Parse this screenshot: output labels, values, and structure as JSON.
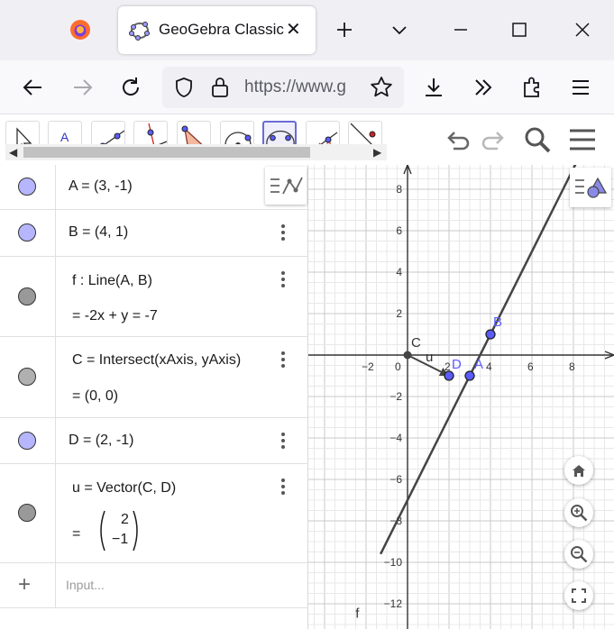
{
  "browser": {
    "tab_title": "GeoGebra Classic",
    "url": "https://www.g"
  },
  "algebra": {
    "rows": [
      {
        "marble": "#b6b6ff",
        "text": "A = (3, -1)"
      },
      {
        "marble": "#b6b6ff",
        "text": "B = (4, 1)"
      },
      {
        "marble": "#999999",
        "text": "f : Line(A, B)",
        "output": "=  -2x + y = -7"
      },
      {
        "marble": "#b0b0b0",
        "text": "C  =  Intersect(xAxis, yAxis)",
        "output": "=  (0, 0)"
      },
      {
        "marble": "#b6b6ff",
        "text": "D = (2, -1)"
      },
      {
        "marble": "#999999",
        "text": "u  =  Vector(C, D)",
        "vector_top": "2",
        "vector_bottom": "−1",
        "output_eq": "="
      }
    ],
    "input_placeholder": "Input...",
    "add_symbol": "+"
  },
  "graph": {
    "x_ticks": [
      "−2",
      "0",
      "2",
      "4",
      "6",
      "8"
    ],
    "y_ticks": [
      "8",
      "6",
      "4",
      "2",
      "−2",
      "−4",
      "−6",
      "−8",
      "−10",
      "−12"
    ],
    "labels": {
      "A": "A",
      "B": "B",
      "C": "C",
      "D": "D",
      "u": "u",
      "f": "f"
    },
    "colors": {
      "point": "#5b5bff",
      "line": "#444444"
    }
  }
}
